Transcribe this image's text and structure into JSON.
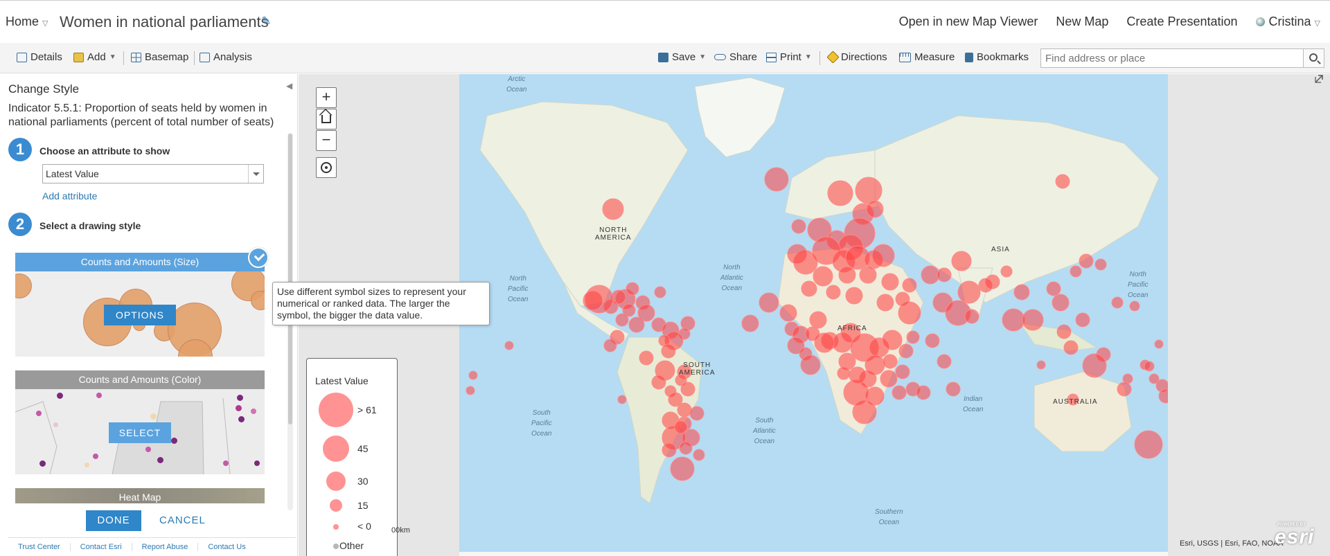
{
  "header": {
    "home": "Home",
    "title": "Women in national parliaments",
    "links": [
      "Open in new Map Viewer",
      "New Map",
      "Create Presentation"
    ],
    "user": "Cristina"
  },
  "toolbar": {
    "details": "Details",
    "add": "Add",
    "basemap": "Basemap",
    "analysis": "Analysis",
    "save": "Save",
    "share": "Share",
    "print": "Print",
    "directions": "Directions",
    "measure": "Measure",
    "bookmarks": "Bookmarks",
    "search_placeholder": "Find address or place"
  },
  "panel": {
    "title": "Change Style",
    "layer_name": "Indicator 5.5.1: Proportion of seats held by women in national parliaments (percent of total number of seats)",
    "step1": {
      "number": "1",
      "label": "Choose an attribute to show",
      "selected": "Latest Value",
      "add_attribute": "Add attribute"
    },
    "step2": {
      "number": "2",
      "label": "Select a drawing style"
    },
    "cards": [
      {
        "title": "Counts and Amounts (Size)",
        "button": "OPTIONS",
        "selected": true
      },
      {
        "title": "Counts and Amounts (Color)",
        "button": "SELECT",
        "selected": false
      },
      {
        "title": "Heat Map",
        "button": "",
        "selected": false
      }
    ],
    "done": "DONE",
    "cancel": "CANCEL",
    "footer": [
      "Trust Center",
      "Contact Esri",
      "Report Abuse",
      "Contact Us"
    ]
  },
  "tooltip": {
    "text": "Use different symbol sizes to represent your numerical or ranked data. The larger the symbol, the bigger the data value."
  },
  "legend": {
    "title": "Latest Value",
    "items": [
      {
        "label": "> 61"
      },
      {
        "label": "45"
      },
      {
        "label": "30"
      },
      {
        "label": "15"
      },
      {
        "label": "< 0"
      },
      {
        "label": "Other"
      }
    ]
  },
  "map": {
    "controls": {
      "zoom_in": "+",
      "zoom_out": "−"
    },
    "labels": {
      "north_america": [
        "NORTH",
        "AMERICA"
      ],
      "south_america": [
        "SOUTH",
        "AMERICA"
      ],
      "africa": "AFRICA",
      "asia": "ASIA",
      "australia": "AUSTRALIA"
    },
    "oceans": {
      "arctic": [
        "Arctic",
        "Ocean"
      ],
      "north_pacific_w": [
        "North",
        "Pacific",
        "Ocean"
      ],
      "north_pacific_e": [
        "North",
        "Pacific",
        "Ocean"
      ],
      "north_atlantic": [
        "North",
        "Atlantic",
        "Ocean"
      ],
      "south_pacific": [
        "South",
        "Pacific",
        "Ocean"
      ],
      "south_atlantic": [
        "South",
        "Atlantic",
        "Ocean"
      ],
      "indian": [
        "Indian",
        "Ocean"
      ],
      "southern": [
        "Southern",
        "Ocean"
      ]
    },
    "scale_text": "00km",
    "attribution": "Esri, USGS | Esri, FAO, NOAA",
    "logo": "esri",
    "logo_small": "POWERED BY",
    "symbol_color": "#ff4040",
    "water_color": "#b5dcf3",
    "land_color": "#eef0e2"
  }
}
